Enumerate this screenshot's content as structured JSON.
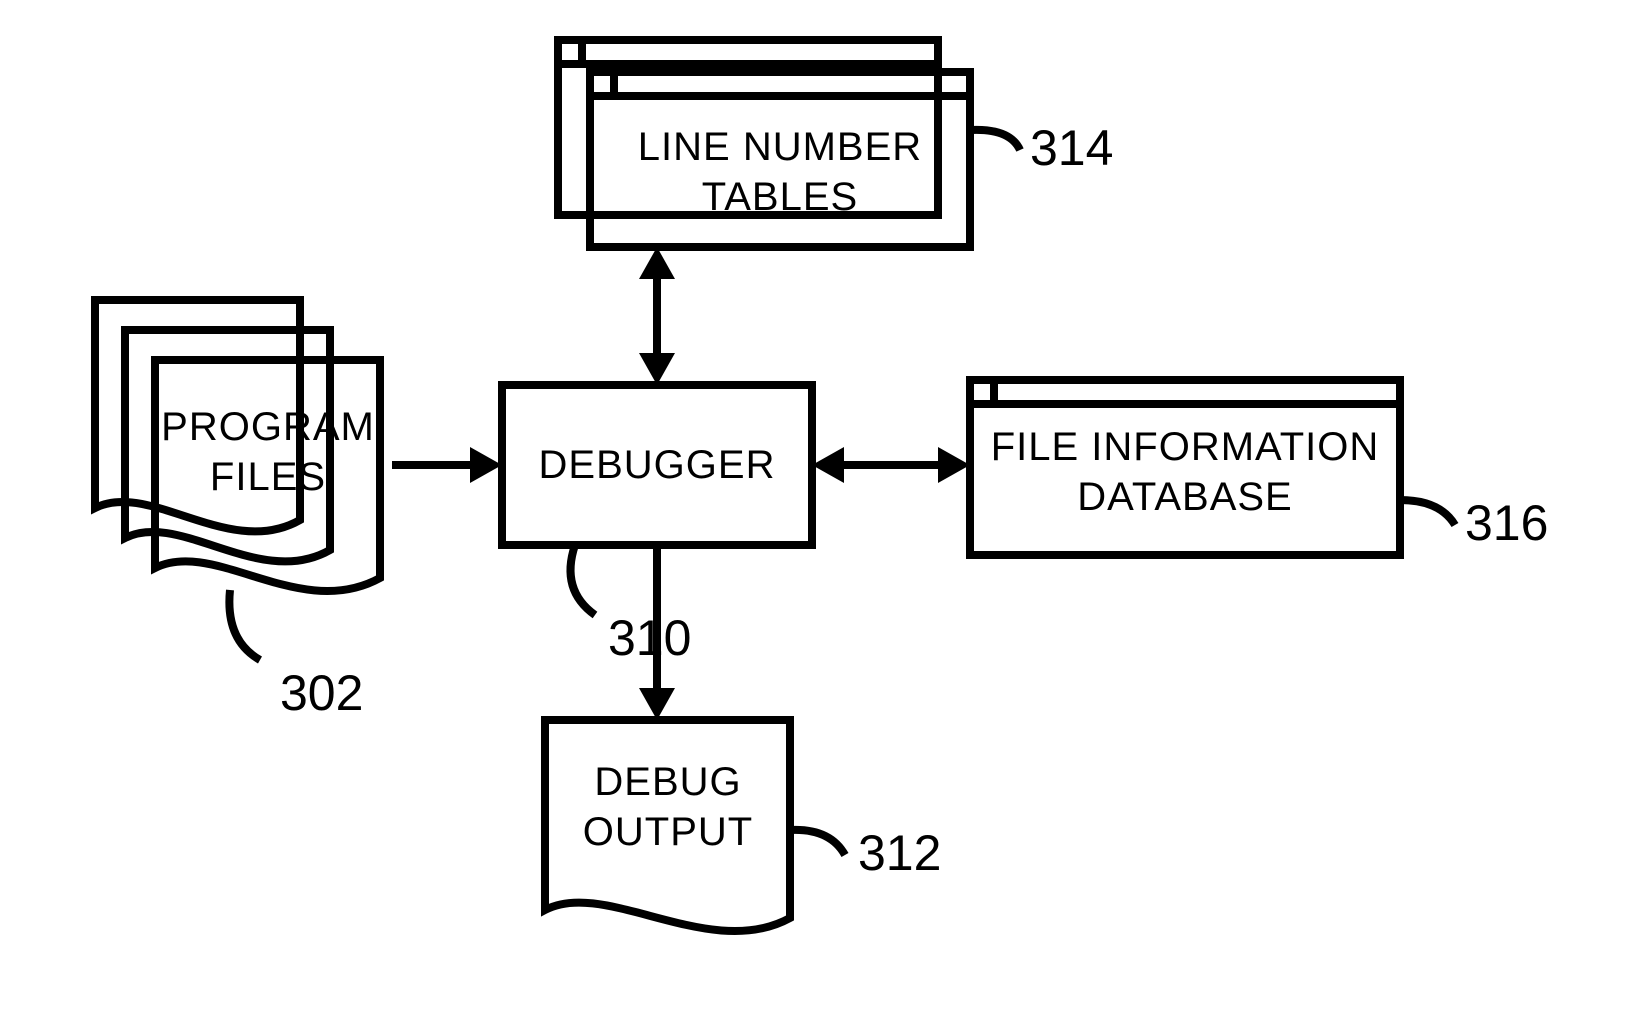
{
  "diagram": {
    "blocks": {
      "program_files": {
        "line1": "PROGRAM",
        "line2": "FILES",
        "ref": "302"
      },
      "debugger": {
        "label": "DEBUGGER",
        "ref": "310"
      },
      "line_tables": {
        "line1": "LINE NUMBER",
        "line2": "TABLES",
        "ref": "314"
      },
      "file_db": {
        "line1": "FILE INFORMATION",
        "line2": "DATABASE",
        "ref": "316"
      },
      "debug_output": {
        "line1": "DEBUG",
        "line2": "OUTPUT",
        "ref": "312"
      }
    }
  }
}
